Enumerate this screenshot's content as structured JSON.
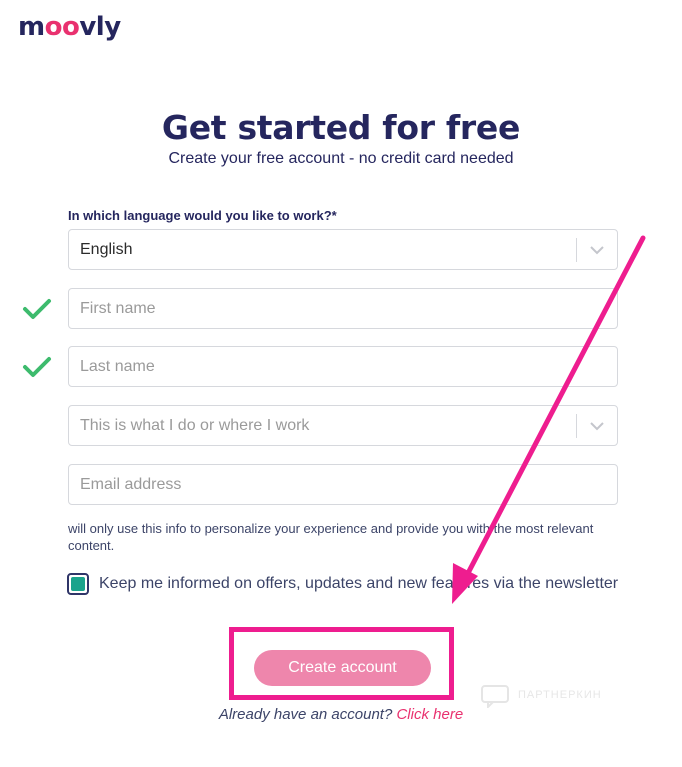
{
  "brand": {
    "logo_start": "m",
    "logo_oo": "oo",
    "logo_end": "vly"
  },
  "header": {
    "title": "Get started for free",
    "subtitle": "Create your free account - no credit card needed"
  },
  "form": {
    "language_label": "In which language would you like to work?*",
    "language_value": "English",
    "first_name_placeholder": "First name",
    "last_name_placeholder": "Last name",
    "work_placeholder": "This is what I do or where I work",
    "email_placeholder": "Email address",
    "privacy_text": "will only use this info to personalize your experience and provide you with the most relevant content.",
    "newsletter_label": "Keep me informed on offers, updates and new features via the newsletter",
    "newsletter_checked": true,
    "create_button": "Create account",
    "already_text": "Already have an account?",
    "login_link": "Click here"
  },
  "watermark": {
    "text": "ПАРТНЕРКИН"
  },
  "colors": {
    "brand_navy": "#25265e",
    "brand_pink": "#e9316f",
    "highlight": "#ee1d8f",
    "button": "#ee86ac",
    "check": "#3dbb6d",
    "checkbox_fill": "#1aa38c"
  },
  "icons": [
    "chevron-down-icon",
    "check-icon",
    "arrow-annotation"
  ]
}
